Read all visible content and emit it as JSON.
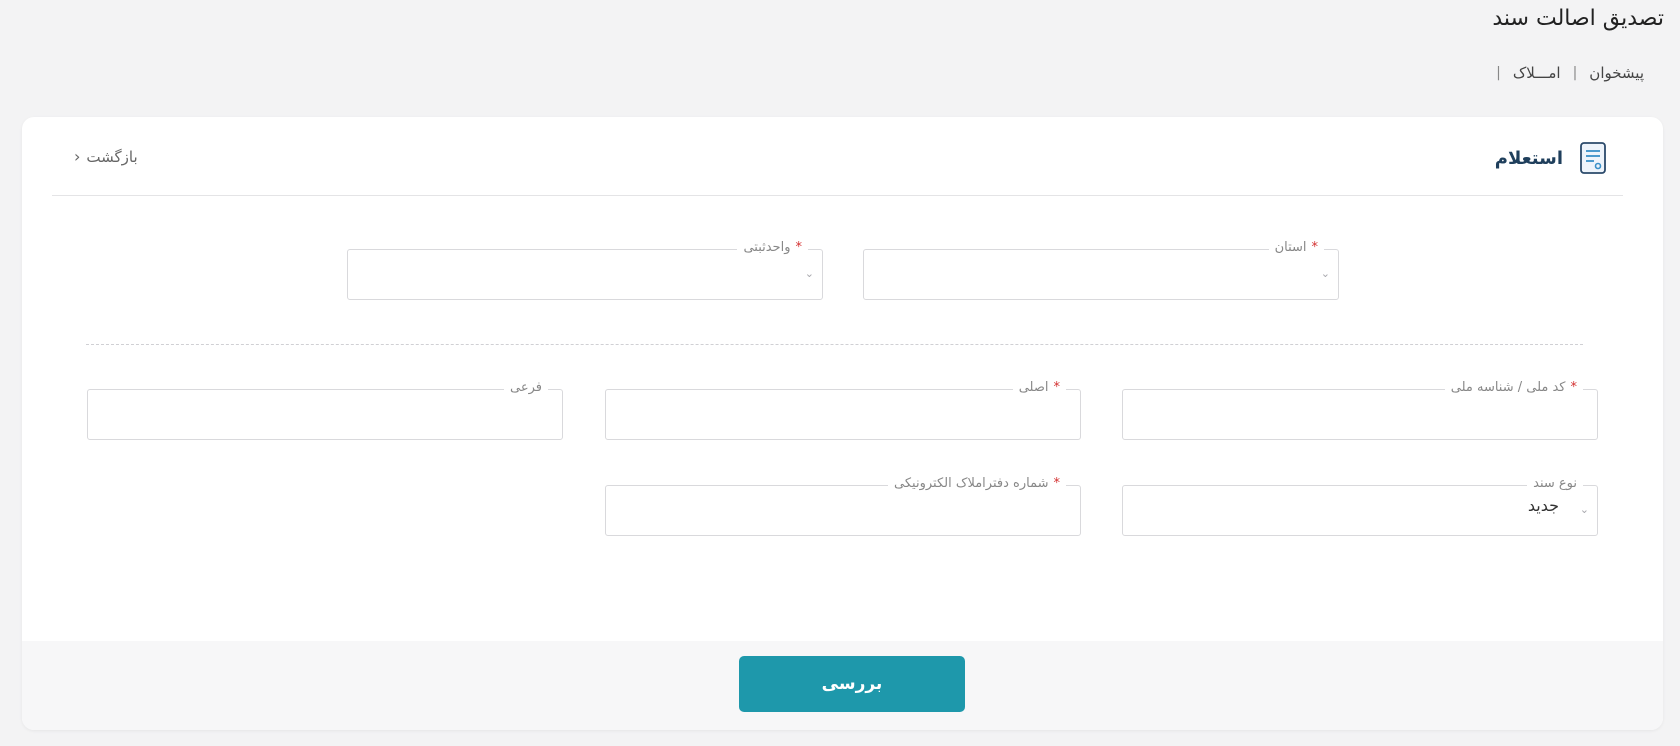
{
  "page": {
    "title": "تصدیق اصالت سند"
  },
  "breadcrumb": {
    "items": [
      "پیشخوان",
      "امـــلاک"
    ],
    "separator": "|"
  },
  "card": {
    "title": "استعلام",
    "back_label": "بازگشت",
    "icon": "document-icon"
  },
  "fields": {
    "province": {
      "label": "استان",
      "required_mark": "*",
      "value": ""
    },
    "registry_unit": {
      "label": "واحدثبتی",
      "required_mark": "*",
      "value": ""
    },
    "national_id": {
      "label": "کد ملی / شناسه ملی",
      "required_mark": "*",
      "value": ""
    },
    "main_plaque": {
      "label": "اصلی",
      "required_mark": "*",
      "value": ""
    },
    "sub_plaque": {
      "label": "فرعی",
      "value": ""
    },
    "doc_type": {
      "label": "نوع سند",
      "value": "جدید"
    },
    "e_book_number": {
      "label": "شماره دفتراملاک الکترونیکی",
      "required_mark": "*",
      "value": ""
    }
  },
  "actions": {
    "submit_label": "بررسی"
  },
  "colors": {
    "primary": "#1e98ab",
    "required": "#d32f2f",
    "title": "#1f3f5c"
  }
}
